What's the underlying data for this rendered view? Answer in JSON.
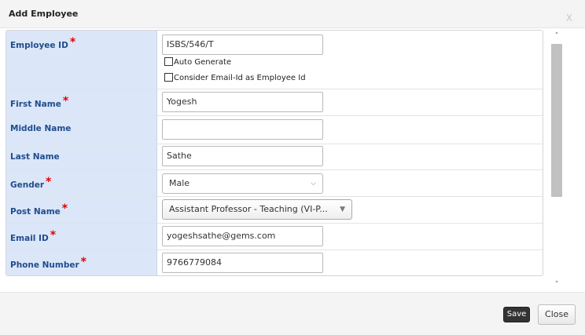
{
  "dialog": {
    "title": "Add Employee",
    "close_glyph": "X"
  },
  "fields": {
    "employee_id": {
      "label": "Employee ID",
      "value": "ISBS/546/T",
      "required": true
    },
    "auto_generate": {
      "label": "Auto Generate",
      "checked": false
    },
    "email_as_id": {
      "label": "Consider Email-Id as Employee Id",
      "checked": false
    },
    "first_name": {
      "label": "First Name",
      "value": "Yogesh",
      "required": true
    },
    "middle_name": {
      "label": "Middle Name",
      "value": ""
    },
    "last_name": {
      "label": "Last Name",
      "value": "Sathe"
    },
    "gender": {
      "label": "Gender",
      "value": "Male",
      "required": true
    },
    "post_name": {
      "label": "Post Name",
      "value": "Assistant Professor - Teaching (VI-P...",
      "required": true
    },
    "email_id": {
      "label": "Email ID",
      "value": "yogeshsathe@gems.com",
      "required": true
    },
    "phone_number": {
      "label": "Phone Number",
      "value": "9766779084",
      "required": true
    }
  },
  "required_mark": "*",
  "scrollbar": {
    "up_glyph": "˄",
    "down_glyph": "˅"
  },
  "footer": {
    "save_label": "Save",
    "close_label": "Close"
  },
  "icons": {
    "dropdown": "chevron-down-icon",
    "dropdown_solid": "caret-down-icon"
  },
  "colors": {
    "label_bg": "#dbe6f8",
    "label_text": "#1f4d8c",
    "required": "#e00000",
    "save_bg": "#333333"
  }
}
